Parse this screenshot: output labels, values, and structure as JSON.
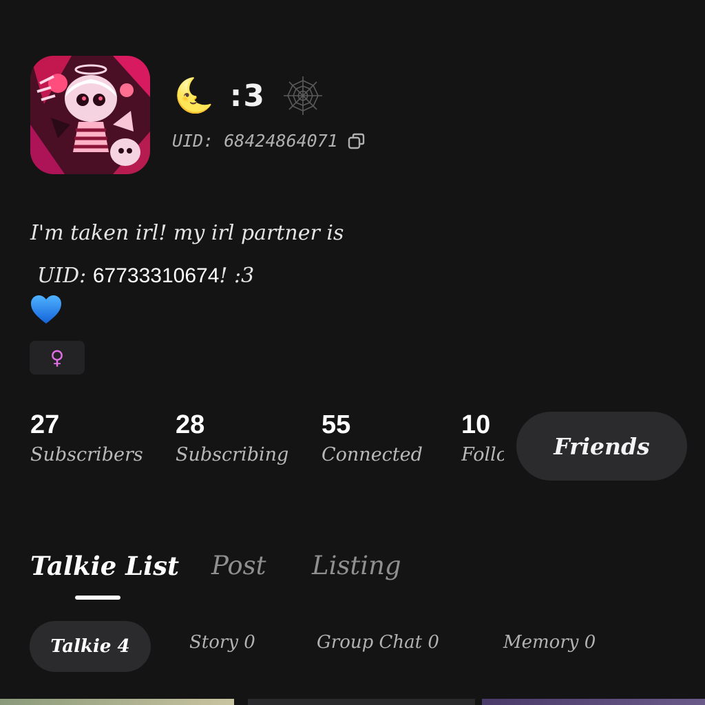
{
  "profile": {
    "moon_emoji": "🌜",
    "display_name": ":3",
    "uid_text": "UID: 68424864071"
  },
  "bio": {
    "line1": "I'm taken irl! my irl partner is",
    "line2_prefix": "UID: ",
    "line2_number": "67733310674",
    "line2_suffix": "! :3"
  },
  "gender": {
    "symbol": "♀"
  },
  "stats": [
    {
      "value": "27",
      "label": "Subscribers"
    },
    {
      "value": "28",
      "label": "Subscribing"
    },
    {
      "value": "55",
      "label": "Connected"
    },
    {
      "value": "10",
      "label": "Follo"
    }
  ],
  "friends_button": "Friends",
  "tabs": [
    {
      "label": "Talkie List",
      "active": true
    },
    {
      "label": "Post",
      "active": false
    },
    {
      "label": "Listing",
      "active": false
    }
  ],
  "subtabs": [
    {
      "label": "Talkie 4",
      "active": true
    },
    {
      "label": "Story 0",
      "active": false
    },
    {
      "label": "Group Chat 0",
      "active": false
    },
    {
      "label": "Memory 0",
      "active": false
    }
  ],
  "colors": {
    "background": "#141415",
    "surface": "#2b2b2e",
    "gender_accent": "#e06ee6",
    "heart": "#1e90ff"
  }
}
